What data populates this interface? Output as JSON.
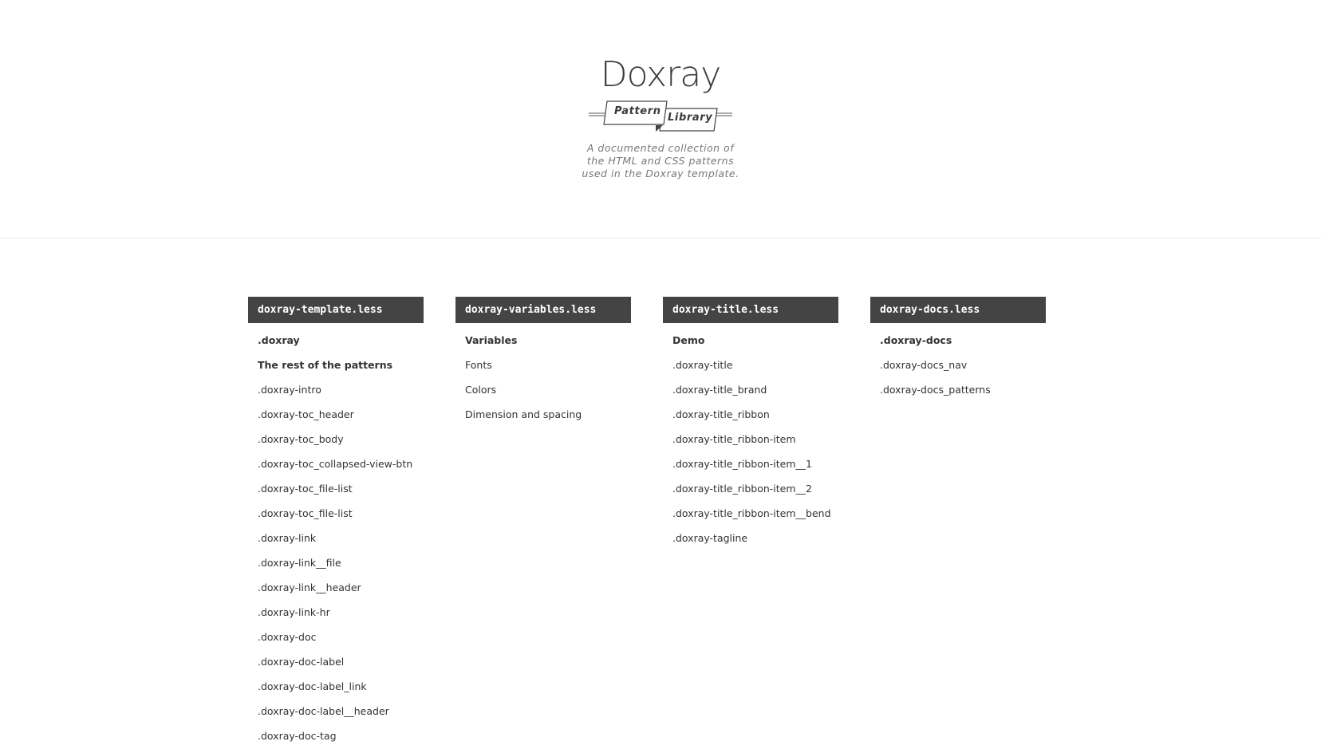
{
  "intro": {
    "brand": "Doxray",
    "ribbon": [
      "Pattern",
      "Library"
    ],
    "tagline": "A documented collection of the HTML and CSS patterns used in the Doxray template."
  },
  "toc": [
    {
      "file": "doxray-template.less",
      "items": [
        {
          "label": ".doxray",
          "strong": true
        },
        {
          "label": "The rest of the patterns",
          "strong": true
        },
        {
          "label": ".doxray-intro"
        },
        {
          "label": ".doxray-toc_header"
        },
        {
          "label": ".doxray-toc_body"
        },
        {
          "label": ".doxray-toc_collapsed-view-btn"
        },
        {
          "label": ".doxray-toc_file-list"
        },
        {
          "label": ".doxray-toc_file-list"
        },
        {
          "label": ".doxray-link"
        },
        {
          "label": ".doxray-link__file"
        },
        {
          "label": ".doxray-link__header"
        },
        {
          "label": ".doxray-link-hr"
        },
        {
          "label": ".doxray-doc"
        },
        {
          "label": ".doxray-doc-label"
        },
        {
          "label": ".doxray-doc-label_link"
        },
        {
          "label": ".doxray-doc-label__header"
        },
        {
          "label": ".doxray-doc-tag"
        }
      ]
    },
    {
      "file": "doxray-variables.less",
      "items": [
        {
          "label": "Variables",
          "strong": true
        },
        {
          "label": "Fonts"
        },
        {
          "label": "Colors"
        },
        {
          "label": "Dimension and spacing"
        }
      ]
    },
    {
      "file": "doxray-title.less",
      "items": [
        {
          "label": "Demo",
          "strong": true
        },
        {
          "label": ".doxray-title"
        },
        {
          "label": ".doxray-title_brand"
        },
        {
          "label": ".doxray-title_ribbon"
        },
        {
          "label": ".doxray-title_ribbon-item"
        },
        {
          "label": ".doxray-title_ribbon-item__1"
        },
        {
          "label": ".doxray-title_ribbon-item__2"
        },
        {
          "label": ".doxray-title_ribbon-item__bend"
        },
        {
          "label": ".doxray-tagline"
        }
      ]
    },
    {
      "file": "doxray-docs.less",
      "items": [
        {
          "label": ".doxray-docs",
          "strong": true
        },
        {
          "label": ".doxray-docs_nav"
        },
        {
          "label": ".doxray-docs_patterns"
        }
      ]
    }
  ]
}
